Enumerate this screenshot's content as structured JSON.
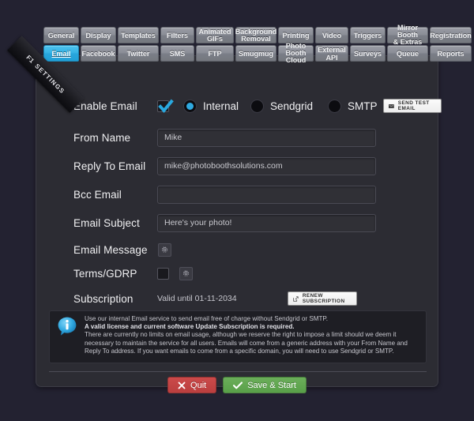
{
  "ribbon": {
    "hotkey": "F1",
    "label": "SETTINGS"
  },
  "tabs": {
    "row1": [
      {
        "label": "General",
        "active": false,
        "name": "tab-general"
      },
      {
        "label": "Display",
        "active": false,
        "name": "tab-display"
      },
      {
        "label": "Templates",
        "active": false,
        "name": "tab-templates"
      },
      {
        "label": "Filters",
        "active": false,
        "name": "tab-filters"
      },
      {
        "label": "Animated\nGIFs",
        "active": false,
        "name": "tab-animated-gifs"
      },
      {
        "label": "Background\nRemoval",
        "active": false,
        "name": "tab-background-removal"
      },
      {
        "label": "Printing",
        "active": false,
        "name": "tab-printing"
      },
      {
        "label": "Video",
        "active": false,
        "name": "tab-video"
      },
      {
        "label": "Triggers",
        "active": false,
        "name": "tab-triggers"
      },
      {
        "label": "Mirror Booth\n& Extras",
        "active": false,
        "name": "tab-mirror-booth-extras"
      },
      {
        "label": "Registration",
        "active": false,
        "name": "tab-registration"
      }
    ],
    "row2": [
      {
        "label": "Email",
        "active": true,
        "name": "tab-email"
      },
      {
        "label": "Facebook",
        "active": false,
        "name": "tab-facebook"
      },
      {
        "label": "Twitter",
        "active": false,
        "name": "tab-twitter"
      },
      {
        "label": "SMS",
        "active": false,
        "name": "tab-sms"
      },
      {
        "label": "FTP",
        "active": false,
        "name": "tab-ftp"
      },
      {
        "label": "Smugmug",
        "active": false,
        "name": "tab-smugmug"
      },
      {
        "label": "Photo Booth\nCloud",
        "active": false,
        "name": "tab-photo-booth-cloud"
      },
      {
        "label": "External API",
        "active": false,
        "name": "tab-external-api"
      },
      {
        "label": "Surveys",
        "active": false,
        "name": "tab-surveys"
      },
      {
        "label": "Queue",
        "active": false,
        "name": "tab-queue"
      },
      {
        "label": "Reports",
        "active": false,
        "name": "tab-reports"
      }
    ]
  },
  "form": {
    "enable_email": {
      "label": "Enable Email",
      "checked": true,
      "providers": [
        {
          "label": "Internal",
          "selected": true
        },
        {
          "label": "Sendgrid",
          "selected": false
        },
        {
          "label": "SMTP",
          "selected": false
        }
      ],
      "send_test_label": "SEND TEST EMAIL"
    },
    "from_name": {
      "label": "From Name",
      "value": "Mike"
    },
    "reply_to_email": {
      "label": "Reply To Email",
      "value": "mike@photoboothsolutions.com"
    },
    "bcc_email": {
      "label": "Bcc Email",
      "value": ""
    },
    "email_subject": {
      "label": "Email Subject",
      "value": "Here's your photo!"
    },
    "email_message": {
      "label": "Email Message"
    },
    "terms_gdrp": {
      "label": "Terms/GDRP",
      "checked": false
    },
    "subscription": {
      "label": "Subscription",
      "value": "Valid until 01-11-2034",
      "renew_label": "RENEW SUBSCRIPTION"
    }
  },
  "info": {
    "line1": "Use our internal Email service to send email free of charge without Sendgrid or SMTP.",
    "line2": "A valid license and current software Update Subscription is required.",
    "line3": "There are currently no limits on email usage, although we reserve the right to impose a limit should we deem it necessary to maintain the service for all users. Emails will come from a generic address with your From Name and Reply To address. If you want emails to come from a specific domain, you will need to use Sendgrid or SMTP."
  },
  "footer": {
    "quit_label": "Quit",
    "save_label": "Save & Start"
  },
  "colors": {
    "accent": "#29a9e0",
    "quit": "#c24545",
    "save": "#62a74f",
    "panel_bg": "#2c2c33",
    "page_bg": "#232231"
  }
}
